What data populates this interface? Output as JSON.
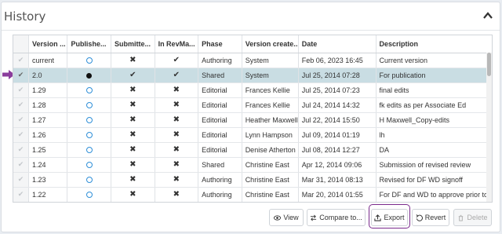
{
  "panel": {
    "title": "History"
  },
  "table": {
    "columns": [
      "",
      "Version ...",
      "Publishe...",
      "Submitte...",
      "In RevMa...",
      "Phase",
      "Version create...",
      "Date",
      "Description"
    ],
    "rows": [
      {
        "version": "current",
        "published": "circle",
        "submitted": "x",
        "inrevma": "check",
        "phase": "Authoring",
        "creator": "System",
        "date": "Feb 06, 2023 16:45",
        "description": "Current version",
        "selected": false
      },
      {
        "version": "2.0",
        "published": "dot",
        "submitted": "check",
        "inrevma": "check",
        "phase": "Shared",
        "creator": "System",
        "date": "Jul 25, 2014 07:28",
        "description": "For publication",
        "selected": true
      },
      {
        "version": "1.29",
        "published": "circle",
        "submitted": "x",
        "inrevma": "x",
        "phase": "Editorial",
        "creator": "Frances Kellie",
        "date": "Jul 25, 2014 07:23",
        "description": "final edits",
        "selected": false
      },
      {
        "version": "1.28",
        "published": "circle",
        "submitted": "x",
        "inrevma": "x",
        "phase": "Editorial",
        "creator": "Frances Kellie",
        "date": "Jul 24, 2014 14:32",
        "description": "fk edits as per Associate Ed",
        "selected": false
      },
      {
        "version": "1.27",
        "published": "circle",
        "submitted": "x",
        "inrevma": "x",
        "phase": "Editorial",
        "creator": "Heather Maxwell",
        "date": "Jul 22, 2014 15:50",
        "description": "H Maxwell_Copy-edits",
        "selected": false
      },
      {
        "version": "1.26",
        "published": "circle",
        "submitted": "x",
        "inrevma": "x",
        "phase": "Editorial",
        "creator": "Lynn Hampson",
        "date": "Jul 09, 2014 01:19",
        "description": "lh",
        "selected": false
      },
      {
        "version": "1.25",
        "published": "circle",
        "submitted": "x",
        "inrevma": "x",
        "phase": "Editorial",
        "creator": "Denise Atherton",
        "date": "Jul 08, 2014 12:27",
        "description": "DA",
        "selected": false
      },
      {
        "version": "1.24",
        "published": "circle",
        "submitted": "x",
        "inrevma": "x",
        "phase": "Shared",
        "creator": "Christine East",
        "date": "Apr 12, 2014 09:06",
        "description": "Submission of revised review",
        "selected": false
      },
      {
        "version": "1.23",
        "published": "circle",
        "submitted": "x",
        "inrevma": "x",
        "phase": "Authoring",
        "creator": "Christine East",
        "date": "Mar 31, 2014 08:13",
        "description": "Revised for DF WD signoff",
        "selected": false
      },
      {
        "version": "1.22",
        "published": "circle",
        "submitted": "x",
        "inrevma": "x",
        "phase": "Authoring",
        "creator": "Christine East",
        "date": "Mar 20, 2014 01:55",
        "description": "For DF and WD to approve prior to submission",
        "selected": false
      }
    ]
  },
  "buttons": {
    "view": "View",
    "compare": "Compare to...",
    "export": "Export",
    "revert": "Revert",
    "delete": "Delete"
  },
  "colors": {
    "selected_row": "#c9dde3",
    "highlight_ring": "#7a2a8c",
    "arrow": "#8a3d9c",
    "circle": "#2f8fd8"
  }
}
